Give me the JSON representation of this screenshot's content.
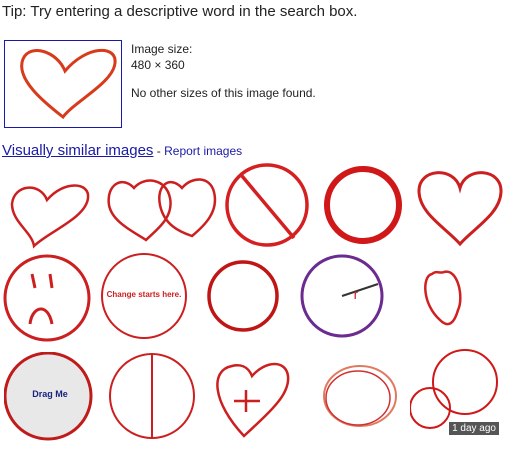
{
  "tip": "Tip: Try entering a descriptive word in the search box.",
  "details": {
    "size_label": "Image size:",
    "dimensions": "480 × 360",
    "other_sizes": "No other sizes of this image found."
  },
  "similar": {
    "link_label": "Visually similar images",
    "separator": " - ",
    "report_label": "Report images"
  },
  "grid": {
    "change_text": "Change starts here.",
    "r_label": "r",
    "drag_label": "Drag Me"
  },
  "badge": "1 day ago",
  "colors": {
    "link": "#1a1aa6",
    "drawing_red": "#cc1f1f",
    "purple": "#6a2c91"
  }
}
